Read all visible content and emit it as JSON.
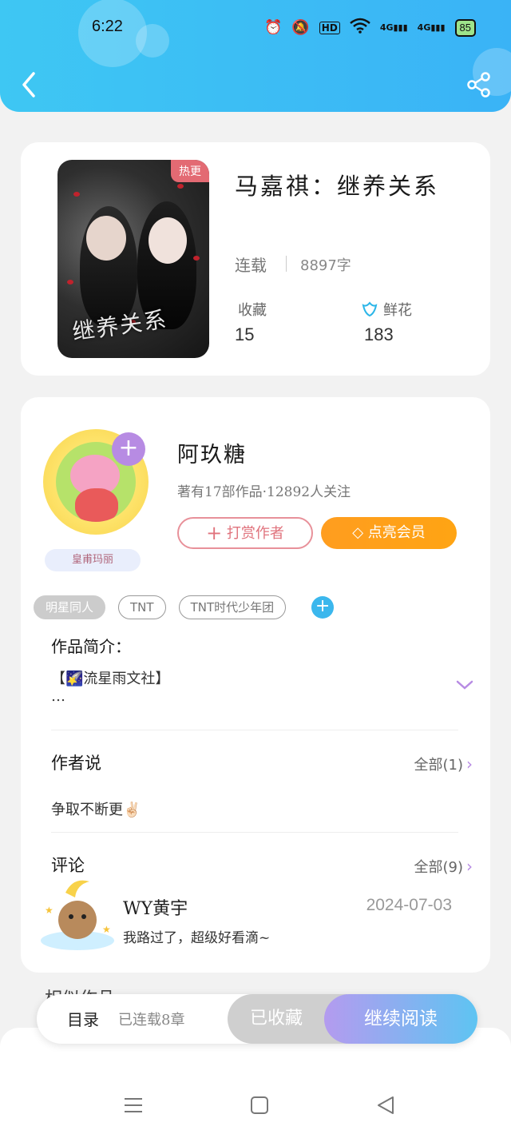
{
  "status_bar": {
    "time": "6:22",
    "network_1": "4G",
    "network_2": "4G",
    "hd_label": "HD",
    "battery": "85"
  },
  "book": {
    "hot_badge": "热更",
    "cover_art_title": "继养关系",
    "title": "马嘉祺：继养关系",
    "status": "连载",
    "word_count": "8897字",
    "favorites_label": "收藏",
    "favorites_value": "15",
    "flowers_label": "鲜花",
    "flowers_value": "183"
  },
  "author": {
    "name": "阿玖糖",
    "meta": "著有17部作品·12892人关注",
    "badge": "皇甫玛丽",
    "tip_button": "打赏作者",
    "vip_button": "点亮会员"
  },
  "tags": [
    "明星同人",
    "TNT",
    "TNT时代少年团"
  ],
  "intro": {
    "title": "作品简介：",
    "line1": "【🌠流星雨文社】",
    "line2": "…"
  },
  "author_says": {
    "title": "作者说",
    "more": "全部(1)",
    "text": "争取不断更✌🏻"
  },
  "comments": {
    "title": "评论",
    "more": "全部(9)",
    "user": "WY黄宇",
    "date": "2024-07-03",
    "text": "我路过了，超级好看滴~"
  },
  "peek_text": "相似作品",
  "action_bar": {
    "toc": "目录",
    "chapters": "已连载8章",
    "collected": "已收藏",
    "read": "继续阅读"
  },
  "colors": {
    "header": "#3ab8f5",
    "accent_purple": "#b78be3",
    "vip_orange": "#ff9d1f",
    "tip_red": "#e0737d"
  }
}
